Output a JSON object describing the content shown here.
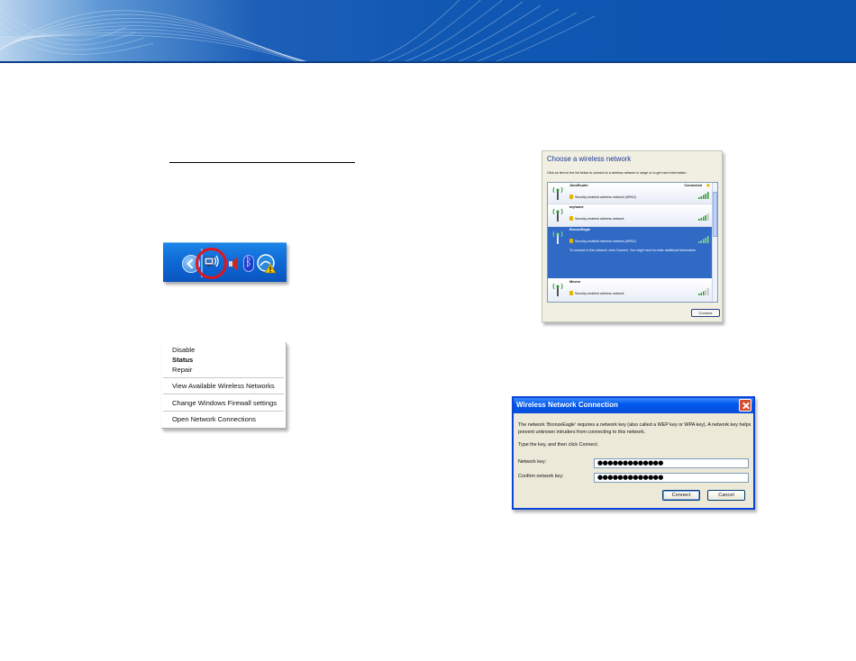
{
  "tray": {
    "icons": [
      "show-hidden-icons-chevron",
      "wireless-network-icon",
      "speaker-icon",
      "bluetooth-icon",
      "security-alert-icon"
    ],
    "colors": {
      "taskbar": "#0f6ad6",
      "highlight_circle": "#e2141b"
    }
  },
  "context_menu": {
    "items": [
      {
        "label": "Disable"
      },
      {
        "label": "Status"
      },
      {
        "label": "Repair"
      },
      {
        "label": "View Available Wireless Networks"
      },
      {
        "label": "Change Windows Firewall settings"
      },
      {
        "label": "Open Network Connections"
      }
    ]
  },
  "choose_network": {
    "title": "Choose a wireless network",
    "description": "Click an item in the list below to connect to a wireless network in range or to get more information.",
    "networks": [
      {
        "name": "JimsRouter",
        "security": "Security-enabled wireless network (WPA2)",
        "status": "Connected"
      },
      {
        "name": "myhome",
        "security": "Security-enabled wireless network"
      },
      {
        "name": "BronzeEagle",
        "security": "Security-enabled wireless network (WPA2)",
        "extra": "To connect to this network, click Connect. You might need to enter additional information."
      },
      {
        "name": "Moxen",
        "security": "Security-enabled wireless network"
      }
    ],
    "connect_label": "Connect",
    "colors": {
      "selection": "#316ac5",
      "title": "#1b3a94"
    }
  },
  "wireless_dialog": {
    "title": "Wireless Network Connection",
    "message": "The network 'BronzeEagle' requires a network key (also called a WEP key or WPA key). A network key helps prevent unknown intruders from connecting to this network.",
    "hint": "Type the key, and then click Connect.",
    "key_label": "Network key:",
    "key_value": "●●●●●●●●●●●●●",
    "confirm_label": "Confirm network key:",
    "confirm_value": "●●●●●●●●●●●●●",
    "connect_label": "Connect",
    "cancel_label": "Cancel",
    "colors": {
      "titlebar": "#0058ee",
      "close": "#d84b2c"
    }
  }
}
